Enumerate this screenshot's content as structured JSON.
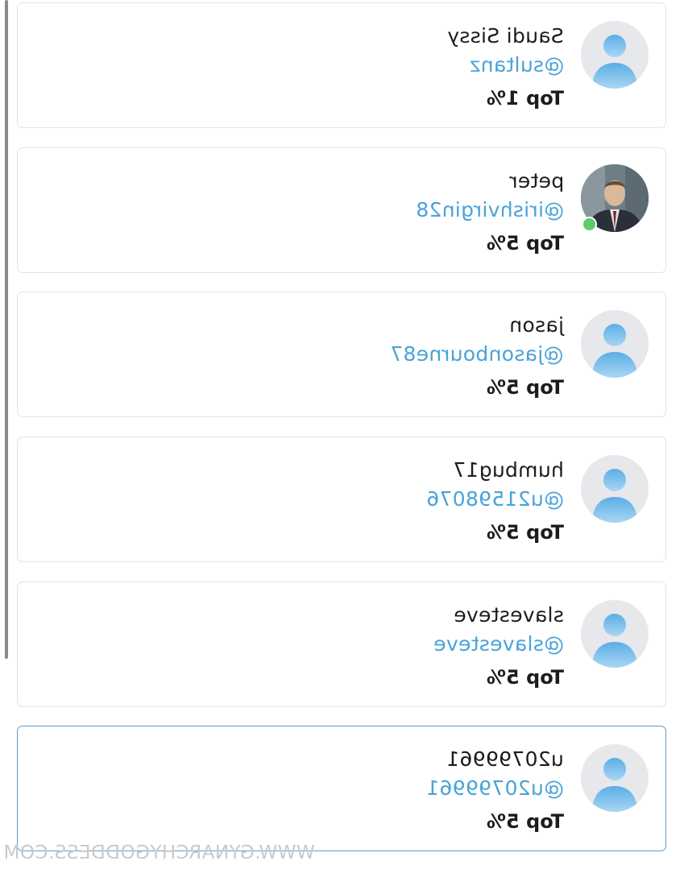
{
  "users": [
    {
      "name": "Saudi Sissy",
      "handle": "@sultanz",
      "rank": "Top 1%",
      "avatar": "default-avatar-icon"
    },
    {
      "name": "peter",
      "handle": "@irishvirgin28",
      "rank": "Top 5%",
      "avatar": "photo",
      "online": true
    },
    {
      "name": "jason",
      "handle": "@jasonbourne87",
      "rank": "Top 5%",
      "avatar": "default-avatar-icon"
    },
    {
      "name": "humbug17",
      "handle": "@u21598076",
      "rank": "Top 5%",
      "avatar": "default-avatar-icon"
    },
    {
      "name": "slavesteve",
      "handle": "@slavesteve",
      "rank": "Top 5%",
      "avatar": "default-avatar-icon"
    },
    {
      "name": "u20799961",
      "handle": "@u20799961",
      "rank": "Top 5%",
      "avatar": "default-avatar-icon",
      "selected": true
    }
  ],
  "watermark": "WWW.GYNARCHYGODDESS.COM",
  "colors": {
    "handle": "#4aa3d8",
    "selected_border": "#5a9ecf",
    "online": "#5ccb6a",
    "avatar_bg": "#e6e8ec",
    "avatar_figure": "#6cb6e8"
  }
}
